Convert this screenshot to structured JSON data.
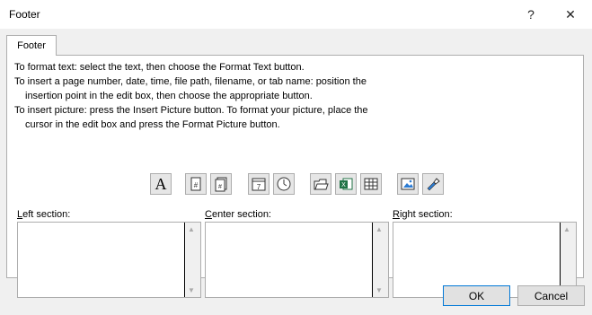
{
  "window": {
    "title": "Footer",
    "help_icon": "?",
    "close_icon": "✕"
  },
  "tab": {
    "label": "Footer"
  },
  "instructions": {
    "line1": "To format text:  select the text, then choose the Format Text button.",
    "line2": "To insert a page number, date, time, file path, filename, or tab name:  position the",
    "line3": "insertion point in the edit box, then choose the appropriate button.",
    "line4": "To insert picture: press the Insert Picture button.  To format your picture, place the",
    "line5": "cursor in the edit box and press the Format Picture button."
  },
  "toolbar": {
    "format_text": "format-text-icon",
    "page_number": "page-number-icon",
    "number_of_pages": "number-of-pages-icon",
    "date": "date-icon",
    "time": "time-icon",
    "file_path": "file-path-icon",
    "filename": "filename-icon",
    "sheet_name": "sheet-name-icon",
    "insert_picture": "insert-picture-icon",
    "format_picture": "format-picture-icon"
  },
  "sections": {
    "left": {
      "accel": "L",
      "rest": "eft section:"
    },
    "center": {
      "accel": "C",
      "rest": "enter section:"
    },
    "right": {
      "accel": "R",
      "rest": "ight section:"
    }
  },
  "buttons": {
    "ok": "OK",
    "cancel": "Cancel"
  }
}
